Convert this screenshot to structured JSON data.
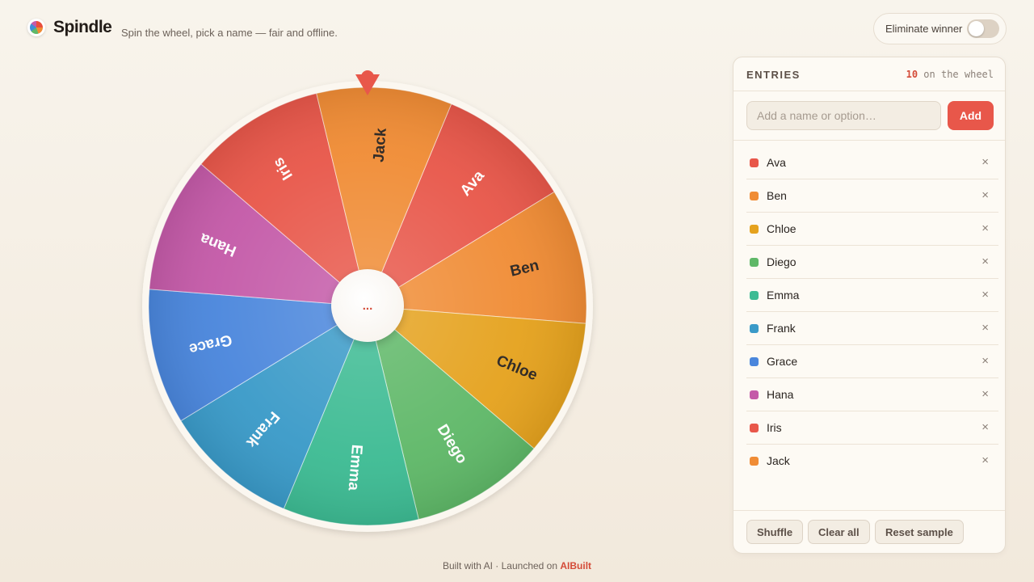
{
  "header": {
    "brand": "Spindle",
    "tagline": "Spin the wheel, pick a name — fair and offline.",
    "eliminate_label": "Eliminate winner",
    "eliminate_on": false
  },
  "wheel": {
    "hub_label": "...",
    "pointer_color": "#e8574a"
  },
  "panel": {
    "title": "ENTRIES",
    "count": "10",
    "count_suffix": " on the wheel",
    "input_placeholder": "Add a name or option…",
    "add_label": "Add",
    "entries": [
      {
        "name": "Ava",
        "color": "#e8574a"
      },
      {
        "name": "Ben",
        "color": "#f08c35"
      },
      {
        "name": "Chloe",
        "color": "#e5a21e"
      },
      {
        "name": "Diego",
        "color": "#5fb868"
      },
      {
        "name": "Emma",
        "color": "#3dbb93"
      },
      {
        "name": "Frank",
        "color": "#3a9ac8"
      },
      {
        "name": "Grace",
        "color": "#4a86dc"
      },
      {
        "name": "Hana",
        "color": "#c45aa8"
      },
      {
        "name": "Iris",
        "color": "#e8574a"
      },
      {
        "name": "Jack",
        "color": "#f08c35"
      }
    ],
    "remove_glyph": "×",
    "shuffle_label": "Shuffle",
    "clear_label": "Clear all",
    "reset_label": "Reset sample"
  },
  "footer": {
    "text": "Built with AI · Launched on ",
    "link": "AIBuilt"
  }
}
